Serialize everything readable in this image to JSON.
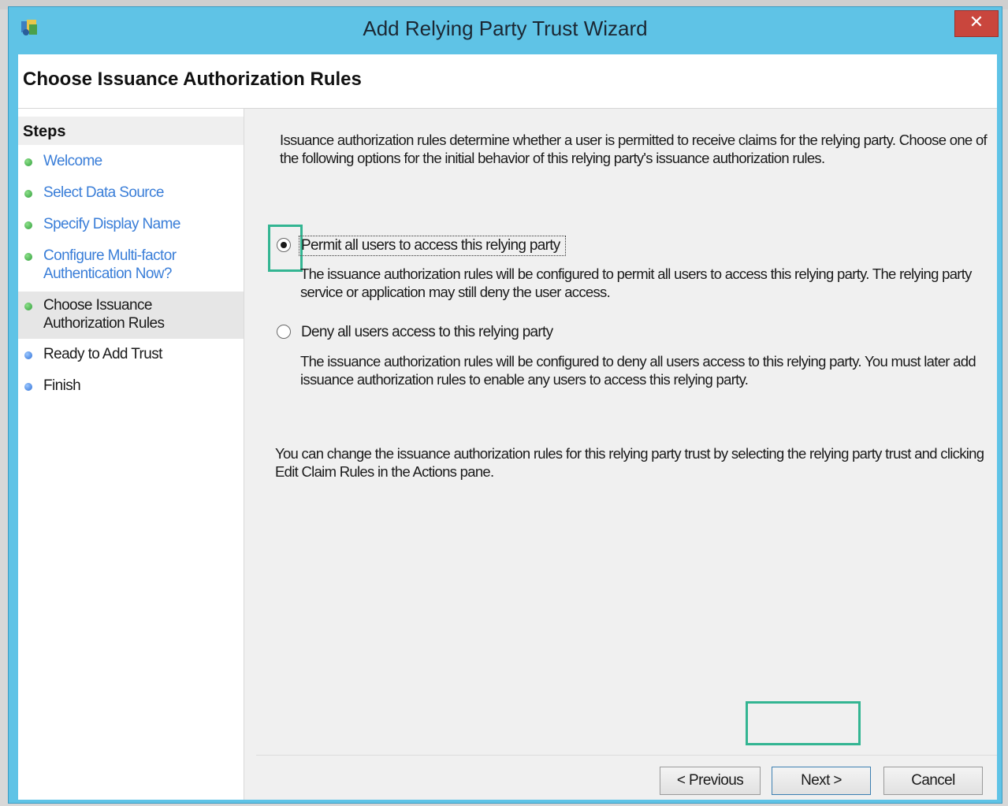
{
  "window": {
    "title": "Add Relying Party Trust Wizard",
    "close_label": "✕"
  },
  "header": {
    "title": "Choose Issuance Authorization Rules"
  },
  "steps": {
    "heading": "Steps",
    "items": [
      {
        "label": "Welcome",
        "state": "done"
      },
      {
        "label": "Select Data Source",
        "state": "done"
      },
      {
        "label": "Specify Display Name",
        "state": "done"
      },
      {
        "label": "Configure Multi-factor Authentication Now?",
        "state": "done"
      },
      {
        "label": "Choose Issuance Authorization Rules",
        "state": "current"
      },
      {
        "label": "Ready to Add Trust",
        "state": "pending"
      },
      {
        "label": "Finish",
        "state": "pending"
      }
    ]
  },
  "main": {
    "intro": "Issuance authorization rules determine whether a user is permitted to receive claims for the relying party. Choose one of the following options for the initial behavior of this relying party's issuance authorization rules.",
    "options": [
      {
        "label": "Permit all users to access this relying party",
        "description": "The issuance authorization rules will be configured to permit all users to access this relying party. The relying party service or application may still deny the user access.",
        "selected": true
      },
      {
        "label": "Deny all users access to this relying party",
        "description": "The issuance authorization rules will be configured to deny all users access to this relying party. You must later add issuance authorization rules to enable any users to access this relying party.",
        "selected": false
      }
    ],
    "note": "You can change the issuance authorization rules for this relying party trust by selecting the relying party trust and clicking Edit Claim Rules in the Actions pane."
  },
  "buttons": {
    "previous": "< Previous",
    "next": "Next >",
    "cancel": "Cancel"
  },
  "colors": {
    "titlebar": "#5fc3e6",
    "highlight": "#33b592",
    "close": "#c9463d",
    "link": "#3a7ed8"
  }
}
